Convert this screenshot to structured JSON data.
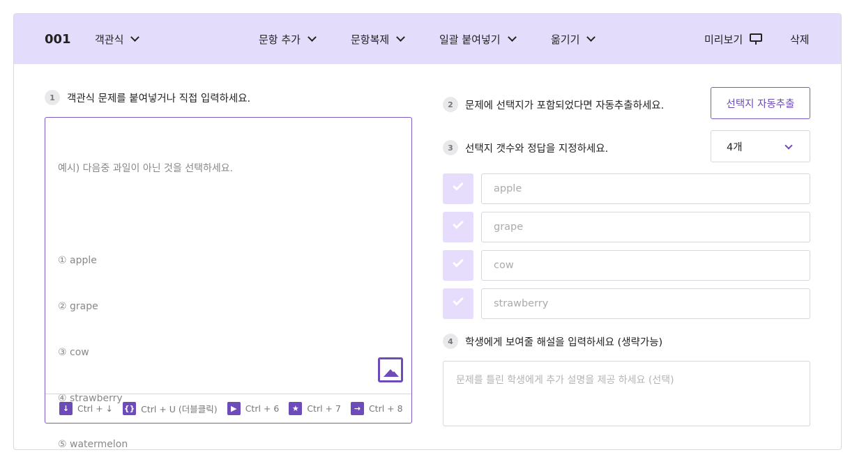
{
  "header": {
    "question_number": "001",
    "question_type": "객관식",
    "menu": [
      {
        "label": "문항 추가"
      },
      {
        "label": "문항복제"
      },
      {
        "label": "일괄 붙여넣기"
      },
      {
        "label": "옮기기"
      }
    ],
    "preview_label": "미리보기",
    "delete_label": "삭제"
  },
  "steps": {
    "s1": {
      "number": "1",
      "text": "객관식 문제를 붙여넣거나 직접 입력하세요."
    },
    "s2": {
      "number": "2",
      "text": "문제에 선택지가 포함되었다면 자동추출하세요."
    },
    "s3": {
      "number": "3",
      "text": "선택지 갯수와 정답을 지정하세요."
    },
    "s4": {
      "number": "4",
      "text": "학생에게 보여줄 해설을 입력하세요 (생략가능)"
    }
  },
  "editor": {
    "placeholder_lines": [
      "예시) 다음중 과일이 아닌 것을 선택하세요.",
      "",
      "① apple",
      "② grape",
      "③ cow",
      "④ strawberry",
      "⑤ watermelon"
    ],
    "shortcuts": [
      {
        "icon": "↓",
        "label": "Ctrl + ↓"
      },
      {
        "icon": "{}",
        "label": "Ctrl + U (더블클릭)"
      },
      {
        "icon": "▶",
        "label": "Ctrl + 6"
      },
      {
        "icon": "★",
        "label": "Ctrl + 7"
      },
      {
        "icon": "→",
        "label": "Ctrl + 8"
      }
    ]
  },
  "auto_extract_label": "선택지 자동추출",
  "choice_count": {
    "selected": "4개"
  },
  "choices": [
    {
      "placeholder": "apple"
    },
    {
      "placeholder": "grape"
    },
    {
      "placeholder": "cow"
    },
    {
      "placeholder": "strawberry"
    }
  ],
  "explanation": {
    "placeholder": "문제를 틀린 학생에게 추가 설명을 제공 하세요 (선택)"
  },
  "colors": {
    "header_bg": "#e4dcfb",
    "accent": "#6d4bb8",
    "check_bg": "#e6dcfb"
  }
}
